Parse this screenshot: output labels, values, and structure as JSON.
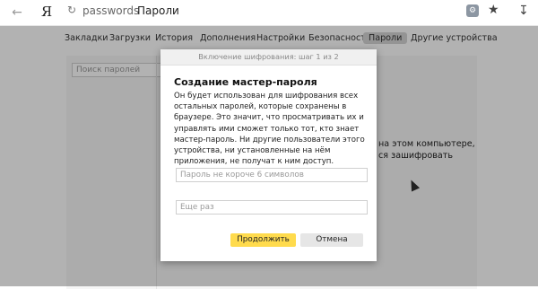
{
  "browser": {
    "back_icon": "back-arrow-icon",
    "brand": "Я",
    "address_host": "passwords",
    "address_title": "Пароли",
    "lock_icon": "lock-icon",
    "extension_icon": "extension-icon",
    "star_icon": "star-icon",
    "download_icon": "download-icon"
  },
  "tabs": [
    {
      "label": "Закладки"
    },
    {
      "label": "Загрузки"
    },
    {
      "label": "История"
    },
    {
      "label": "Дополнения"
    },
    {
      "label": "Настройки"
    },
    {
      "label": "Безопасность"
    },
    {
      "label": "Пароли"
    },
    {
      "label": "Другие устройства"
    }
  ],
  "content": {
    "search_placeholder": "Поиск паролей",
    "info_line1": "на этом компьютере,",
    "info_line2": "ся зашифровать"
  },
  "dialog": {
    "step": "Включение шифрования: шаг 1 из 2",
    "title": "Создание мастер-пароля",
    "text": "Он будет использован для шифрования всех остальных паролей, которые сохранены в браузере. Это значит, что просматривать их и управлять ими сможет только тот, кто знает мастер-пароль. Ни другие пользователи этого устройства, ни установленные на нём приложения, не получат к ним доступ.",
    "password_placeholder": "Пароль не короче 6 символов",
    "repeat_placeholder": "Еще раз",
    "continue_label": "Продолжить",
    "cancel_label": "Отмена"
  }
}
